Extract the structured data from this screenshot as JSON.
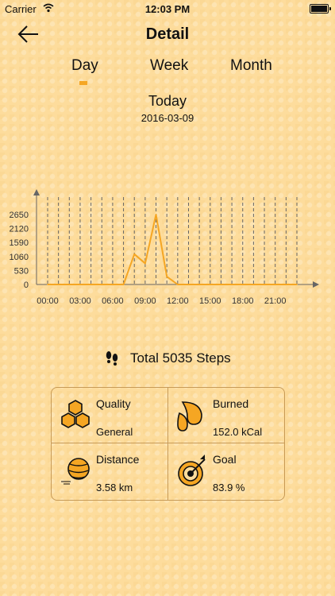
{
  "status": {
    "carrier": "Carrier",
    "time": "12:03 PM"
  },
  "nav": {
    "title": "Detail"
  },
  "tabs": [
    {
      "label": "Day",
      "selected": true
    },
    {
      "label": "Week",
      "selected": false
    },
    {
      "label": "Month",
      "selected": false
    }
  ],
  "header": {
    "title": "Today",
    "date": "2016-03-09"
  },
  "chart_data": {
    "type": "line",
    "x_tick_labels": [
      "00:00",
      "03:00",
      "06:00",
      "09:00",
      "12:00",
      "15:00",
      "18:00",
      "21:00"
    ],
    "y_tick_labels": [
      "0",
      "530",
      "1060",
      "1590",
      "2120",
      "2650"
    ],
    "ylim": [
      0,
      2650
    ],
    "xlim": [
      0,
      23
    ],
    "x": [
      0,
      1,
      2,
      3,
      4,
      5,
      6,
      7,
      8,
      9,
      10,
      11,
      12,
      13,
      14,
      15,
      16,
      17,
      18,
      19,
      20,
      21,
      22,
      23
    ],
    "values": [
      0,
      0,
      0,
      0,
      0,
      0,
      0,
      0,
      1150,
      800,
      2650,
      300,
      0,
      0,
      0,
      0,
      0,
      0,
      0,
      0,
      0,
      0,
      0,
      0
    ],
    "grid": true,
    "color": "#f5a623"
  },
  "summary": {
    "total_text": "Total 5035 Steps"
  },
  "stats": [
    {
      "label": "Quality",
      "value": "General",
      "icon": "honeycomb-icon"
    },
    {
      "label": "Burned",
      "value": "152.0 kCal",
      "icon": "drops-icon"
    },
    {
      "label": "Distance",
      "value": "3.58 km",
      "icon": "ball-icon"
    },
    {
      "label": "Goal",
      "value": "83.9 %",
      "icon": "target-icon"
    }
  ],
  "colors": {
    "background": "#fddc9c",
    "accent": "#f5a623",
    "grid": "#666666"
  }
}
